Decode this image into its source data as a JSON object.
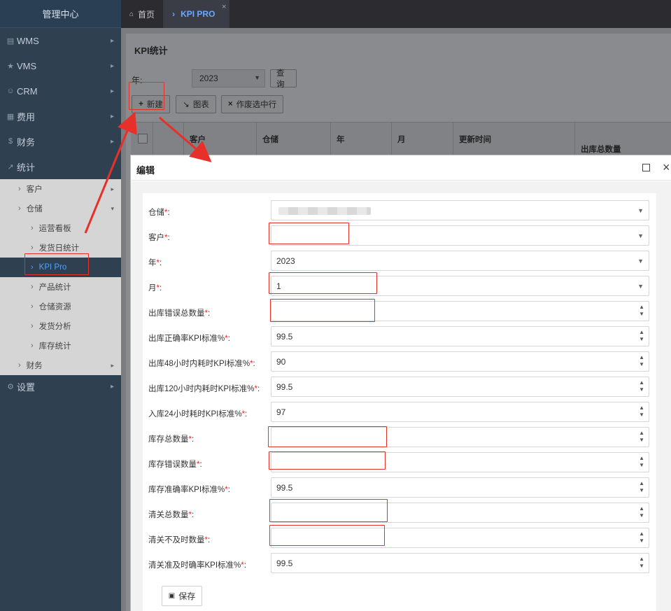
{
  "sidebar": {
    "header": "管理中心",
    "items": [
      {
        "label": "WMS",
        "icon": "bank-icon"
      },
      {
        "label": "VMS",
        "icon": "star-icon"
      },
      {
        "label": "CRM",
        "icon": "user-icon"
      },
      {
        "label": "费用",
        "icon": "table-icon"
      },
      {
        "label": "财务",
        "icon": "dollar-icon"
      },
      {
        "label": "统计",
        "icon": "chart-icon"
      }
    ],
    "sub": {
      "customer": "客户",
      "warehouse": "仓储",
      "warehouse_children": [
        "运营看板",
        "发货日统计",
        "KPI Pro",
        "产品统计",
        "仓储资源",
        "发货分析",
        "库存统计"
      ],
      "finance": "财务"
    },
    "settings": "设置"
  },
  "tabs": {
    "home": "首页",
    "kpi": "KPI PRO"
  },
  "panel": {
    "title": "KPI统计",
    "year_label": "年:",
    "year_value": "2023",
    "query_button": "查询",
    "new_button": "新建",
    "chart_button": "图表",
    "void_button": "作废选中行",
    "columns": [
      "客户",
      "仓储",
      "年",
      "月",
      "更新时间",
      "出库总数量"
    ]
  },
  "dialog": {
    "title": "编辑",
    "save_button": "保存",
    "fields": [
      {
        "label": "仓储",
        "value": "",
        "type": "select"
      },
      {
        "label": "客户",
        "value": "",
        "type": "select"
      },
      {
        "label": "年",
        "value": "2023",
        "type": "select"
      },
      {
        "label": "月",
        "value": "1",
        "type": "select"
      },
      {
        "label": "出库错误总数量",
        "value": "",
        "type": "number"
      },
      {
        "label": "出库正确率KPI标准%",
        "value": "99.5",
        "type": "number"
      },
      {
        "label": "出库48小时内耗时KPI标准%",
        "value": "90",
        "type": "number"
      },
      {
        "label": "出库120小时内耗时KPI标准%",
        "value": "99.5",
        "type": "number"
      },
      {
        "label": "入库24小时耗时KPI标准%",
        "value": "97",
        "type": "number"
      },
      {
        "label": "库存总数量",
        "value": "",
        "type": "number"
      },
      {
        "label": "库存错误数量",
        "value": "",
        "type": "number"
      },
      {
        "label": "库存准确率KPI标准%",
        "value": "99.5",
        "type": "number"
      },
      {
        "label": "清关总数量",
        "value": "",
        "type": "number"
      },
      {
        "label": "清关不及时数量",
        "value": "",
        "type": "number"
      },
      {
        "label": "清关准及时确率KPI标准%",
        "value": "99.5",
        "type": "number"
      }
    ]
  },
  "colors": {
    "sidebar_bg": "#2f4050",
    "accent": "#4da3ff",
    "annotation_red": "#e8302a",
    "required": "#e22"
  }
}
